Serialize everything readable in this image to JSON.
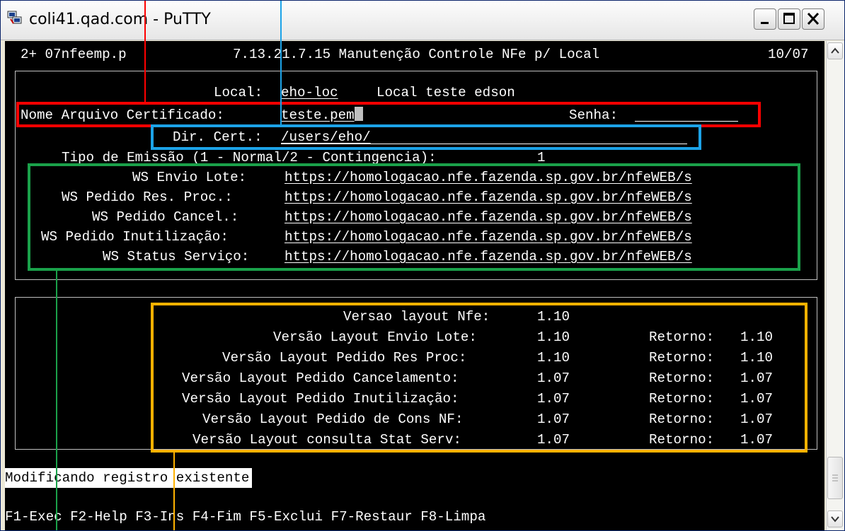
{
  "window": {
    "title": "coli41.qad.com - PuTTY"
  },
  "terminal": {
    "header": {
      "program": "2+ 07nfeemp.p",
      "menu": "7.13.21.7.15 Manutenção Controle NFe p/ Local",
      "date": "10/07"
    },
    "local": {
      "label": "Local:",
      "code": "eho-loc",
      "desc": "Local teste edson"
    },
    "cert": {
      "label": "Nome Arquivo Certificado:",
      "value": "teste.pem",
      "senha_label": "Senha:",
      "senha_value": ""
    },
    "dir": {
      "label": "Dir. Cert.:",
      "value": "/users/eho/"
    },
    "emissao": {
      "label": "Tipo de Emissão (1 - Normal/2 - Contingencia):",
      "value": "1"
    },
    "ws": [
      {
        "label": "WS Envio Lote:",
        "url": "https://homologacao.nfe.fazenda.sp.gov.br/nfeWEB/s"
      },
      {
        "label": "WS Pedido Res. Proc.:",
        "url": "https://homologacao.nfe.fazenda.sp.gov.br/nfeWEB/s"
      },
      {
        "label": "WS Pedido Cancel.:",
        "url": "https://homologacao.nfe.fazenda.sp.gov.br/nfeWEB/s"
      },
      {
        "label": "WS Pedido Inutilização:",
        "url": "https://homologacao.nfe.fazenda.sp.gov.br/nfeWEB/s"
      },
      {
        "label": "WS Status Serviço:",
        "url": "https://homologacao.nfe.fazenda.sp.gov.br/nfeWEB/s"
      }
    ],
    "versions": [
      {
        "label": "Versao layout Nfe:",
        "value": "1.10",
        "ret_label": "",
        "ret_value": ""
      },
      {
        "label": "Versão Layout Envio Lote:",
        "value": "1.10",
        "ret_label": "Retorno:",
        "ret_value": "1.10"
      },
      {
        "label": "Versão Layout Pedido Res Proc:",
        "value": "1.10",
        "ret_label": "Retorno:",
        "ret_value": "1.10"
      },
      {
        "label": "Versão Layout Pedido Cancelamento:",
        "value": "1.07",
        "ret_label": "Retorno:",
        "ret_value": "1.07"
      },
      {
        "label": "Versão Layout Pedido Inutilização:",
        "value": "1.07",
        "ret_label": "Retorno:",
        "ret_value": "1.07"
      },
      {
        "label": "Versão Layout Pedido de Cons NF:",
        "value": "1.07",
        "ret_label": "Retorno:",
        "ret_value": "1.07"
      },
      {
        "label": "Versão Layout consulta Stat Serv:",
        "value": "1.07",
        "ret_label": "Retorno:",
        "ret_value": "1.07"
      }
    ],
    "status_message": "Modificando registro existente",
    "function_keys": "F1-Exec F2-Help F3-Ins F4-Fim F5-Exclui F7-Restaur F8-Limpa"
  },
  "colors": {
    "annotation_red": "#ff0000",
    "annotation_blue": "#1ca3e8",
    "annotation_green": "#1aa14a",
    "annotation_orange": "#ffb200"
  }
}
